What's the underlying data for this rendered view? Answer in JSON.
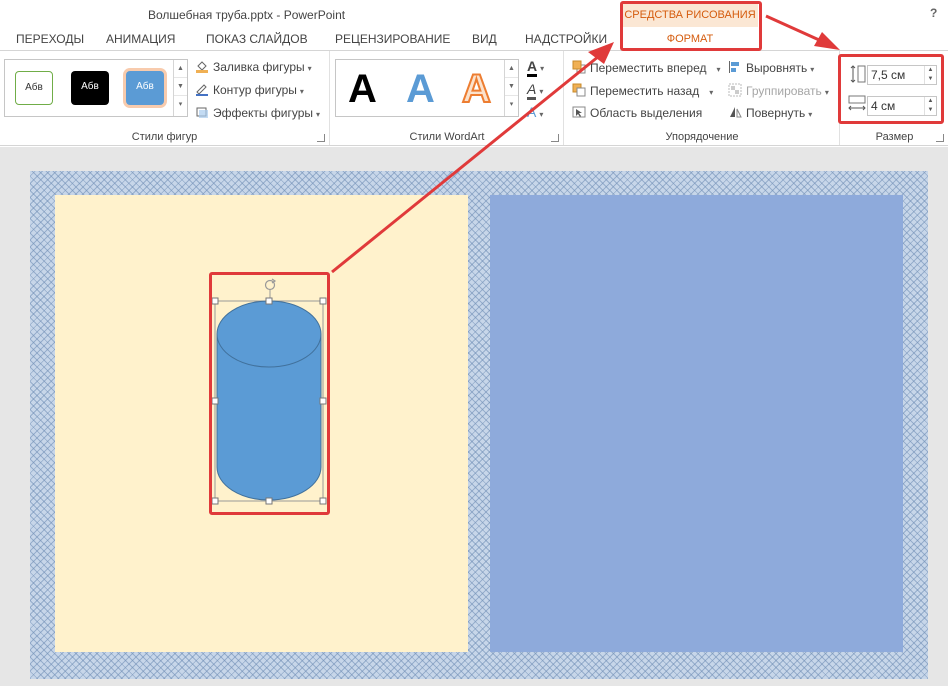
{
  "title_bar": {
    "document_title": "Волшебная труба.pptx - PowerPoint",
    "help_label": "?"
  },
  "contextual_tabs": {
    "group_label": "СРЕДСТВА РИСОВАНИЯ",
    "tab_label": "ФОРМАТ"
  },
  "tabs": [
    "ПЕРЕХОДЫ",
    "АНИМАЦИЯ",
    "ПОКАЗ СЛАЙДОВ",
    "РЕЦЕНЗИРОВАНИЕ",
    "ВИД",
    "НАДСТРОЙКИ"
  ],
  "ribbon": {
    "shape_styles": {
      "label": "Стили фигур",
      "swatches": [
        "Абв",
        "Абв",
        "Абв"
      ],
      "fill_label": "Заливка фигуры",
      "outline_label": "Контур фигуры",
      "effects_label": "Эффекты фигуры"
    },
    "wordart": {
      "label": "Стили WordArt",
      "letters": [
        "A",
        "A",
        "A"
      ],
      "text_fill_letter": "A",
      "text_outline_letter": "A",
      "text_effects_letter": "A"
    },
    "arrange": {
      "label": "Упорядочение",
      "bring_forward_label": "Переместить вперед",
      "send_backward_label": "Переместить назад",
      "selection_pane_label": "Область выделения",
      "align_label": "Выровнять",
      "group_label": "Группировать",
      "rotate_label": "Повернуть"
    },
    "size": {
      "label": "Размер",
      "height_value": "7,5 см",
      "width_value": "4 см"
    }
  },
  "colors": {
    "accent_orange": "#d55c0e",
    "callout_red": "#e03a3a",
    "cylinder_fill": "#5b9bd5",
    "left_panel": "#fff2cc",
    "right_panel": "#8eaadb"
  }
}
